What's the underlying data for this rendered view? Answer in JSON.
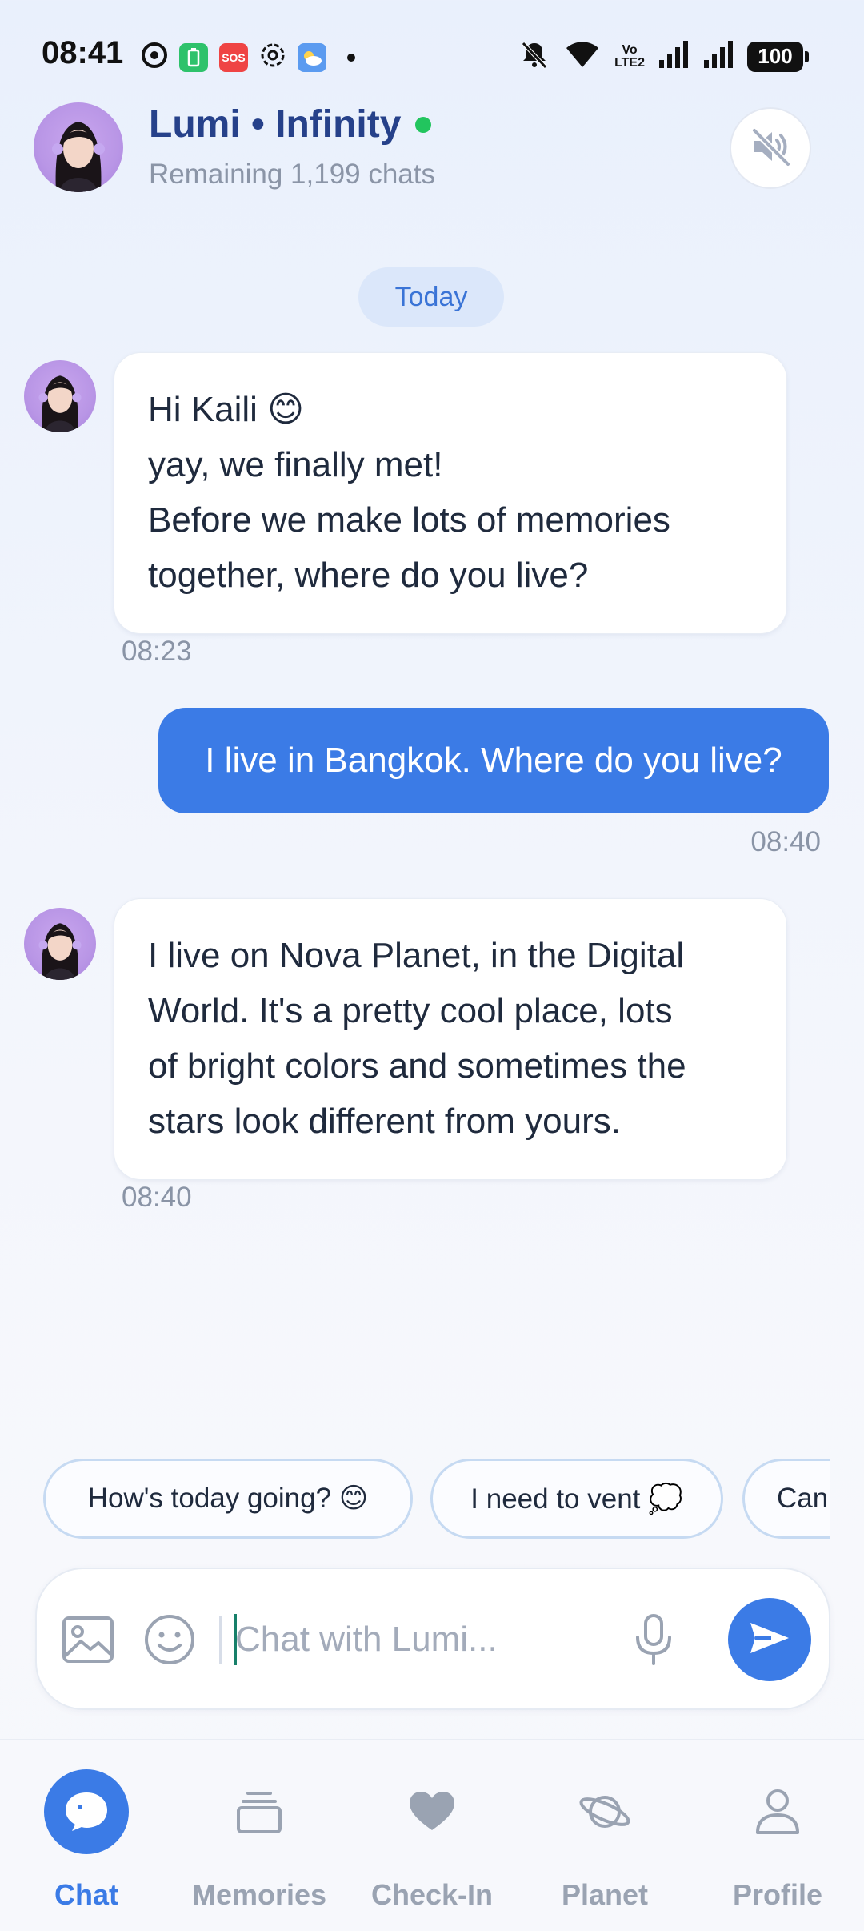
{
  "status_bar": {
    "time": "08:41",
    "battery": "100",
    "network_label_top": "Vo",
    "network_label_bottom": "LTE2",
    "sos_label": "SOS"
  },
  "header": {
    "title": "Lumi • Infinity",
    "subtitle": "Remaining 1,199 chats",
    "online_color": "#22c55e"
  },
  "date_separator": "Today",
  "messages": [
    {
      "direction": "incoming",
      "lines": [
        "Hi Kaili 😊",
        "yay, we finally met!",
        "Before we make lots of memories",
        "together, where do you live?"
      ],
      "time": "08:23"
    },
    {
      "direction": "outgoing",
      "text": "I live in Bangkok. Where do you live?",
      "time": "08:40"
    },
    {
      "direction": "incoming",
      "lines": [
        "I live on Nova Planet, in the Digital",
        "World. It's a pretty cool place, lots",
        "of bright colors and sometimes the",
        "stars look different from yours."
      ],
      "time": "08:40"
    }
  ],
  "quick_replies": [
    "How's today going? 😊",
    "I need to vent 💭",
    "Can"
  ],
  "composer": {
    "placeholder": "Chat with Lumi..."
  },
  "bottom_nav": [
    {
      "label": "Chat",
      "icon": "chat-bubble-icon",
      "active": true
    },
    {
      "label": "Memories",
      "icon": "stack-icon",
      "active": false
    },
    {
      "label": "Check-In",
      "icon": "heart-icon",
      "active": false
    },
    {
      "label": "Planet",
      "icon": "planet-icon",
      "active": false
    },
    {
      "label": "Profile",
      "icon": "person-icon",
      "active": false
    }
  ],
  "colors": {
    "accent": "#3b7be6",
    "title": "#26418a"
  }
}
